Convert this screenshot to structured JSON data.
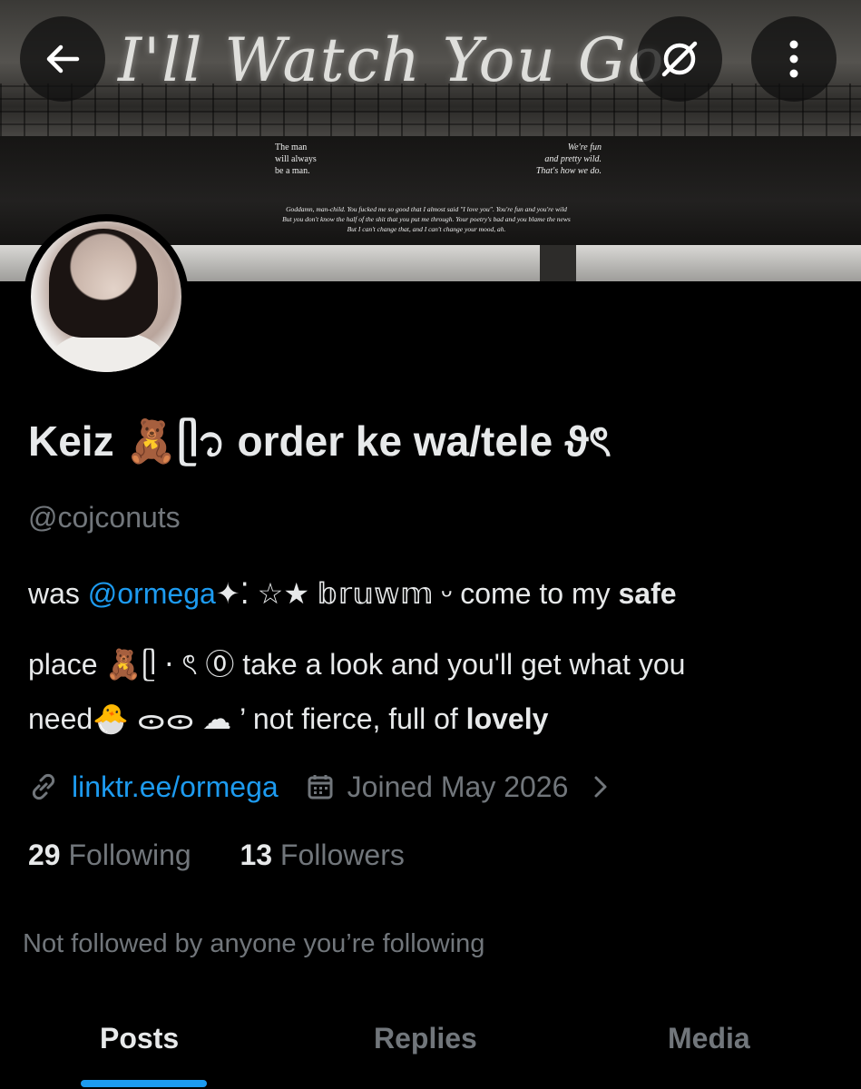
{
  "banner": {
    "title": "I'll Watch You Go",
    "text_left": "The man\nwill always\nbe a man.",
    "text_right": "We're fun\nand pretty wild.\nThat's how we do.",
    "lyrics": "Goddamn, man-child. You fucked me so good that I almost said \"I love you\". You're fun and you're wild\nBut you don't know the half of the shit that you put me through. Your poetry's bad and you blame the news\nBut I can't change that, and I can't change your mood, ah."
  },
  "top_bar": {
    "back_icon": "arrow-left-icon",
    "hide_icon": "eye-slash-icon",
    "more_icon": "vertical-dots-icon"
  },
  "profile": {
    "display_name": "Keiz 🧸ᥫ᭡ order ke wa/tele ϑৎ",
    "handle": "@cojconuts",
    "bio": {
      "line1_prefix": "was ",
      "line1_mention": "@ormega",
      "line1_mid": "✦⁚ ☆★ 𝕓𝕣𝕦𝕨𝕞 ᵕ come to my ",
      "line1_bold": "safe",
      "line2": "place 🧸ᥫ ⋅ ৎ ⓪ take a look and you'll get what you",
      "line3_prefix": "need🐣 ᯣᯣ ☁︎ ’ not fierce, full of ",
      "line3_bold": "lovely"
    },
    "link": "linktr.ee/ormega",
    "joined": "Joined May 2026",
    "following_count": "29",
    "following_label": "Following",
    "followers_count": "13",
    "followers_label": "Followers",
    "followed_by": "Not followed by anyone you’re following"
  },
  "tabs": [
    {
      "label": "Posts",
      "active": true
    },
    {
      "label": "Replies",
      "active": false
    },
    {
      "label": "Media",
      "active": false
    }
  ],
  "colors": {
    "background": "#000000",
    "text": "#e7e9ea",
    "muted": "#71767b",
    "accent": "#1d9bf0"
  }
}
